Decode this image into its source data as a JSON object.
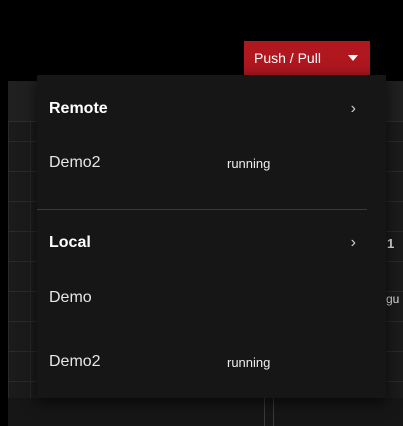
{
  "toolbar": {
    "push_pull_label": "Push / Pull",
    "accent_color": "#b0171f"
  },
  "background": {
    "peek_1": "1",
    "peek_2": "gu"
  },
  "menu": {
    "remote": {
      "header": "Remote",
      "chevron": "›",
      "items": [
        {
          "name": "Demo2",
          "status": "running"
        }
      ]
    },
    "local": {
      "header": "Local",
      "chevron": "›",
      "items": [
        {
          "name": "Demo",
          "status": ""
        },
        {
          "name": "Demo2",
          "status": "running"
        }
      ]
    }
  }
}
